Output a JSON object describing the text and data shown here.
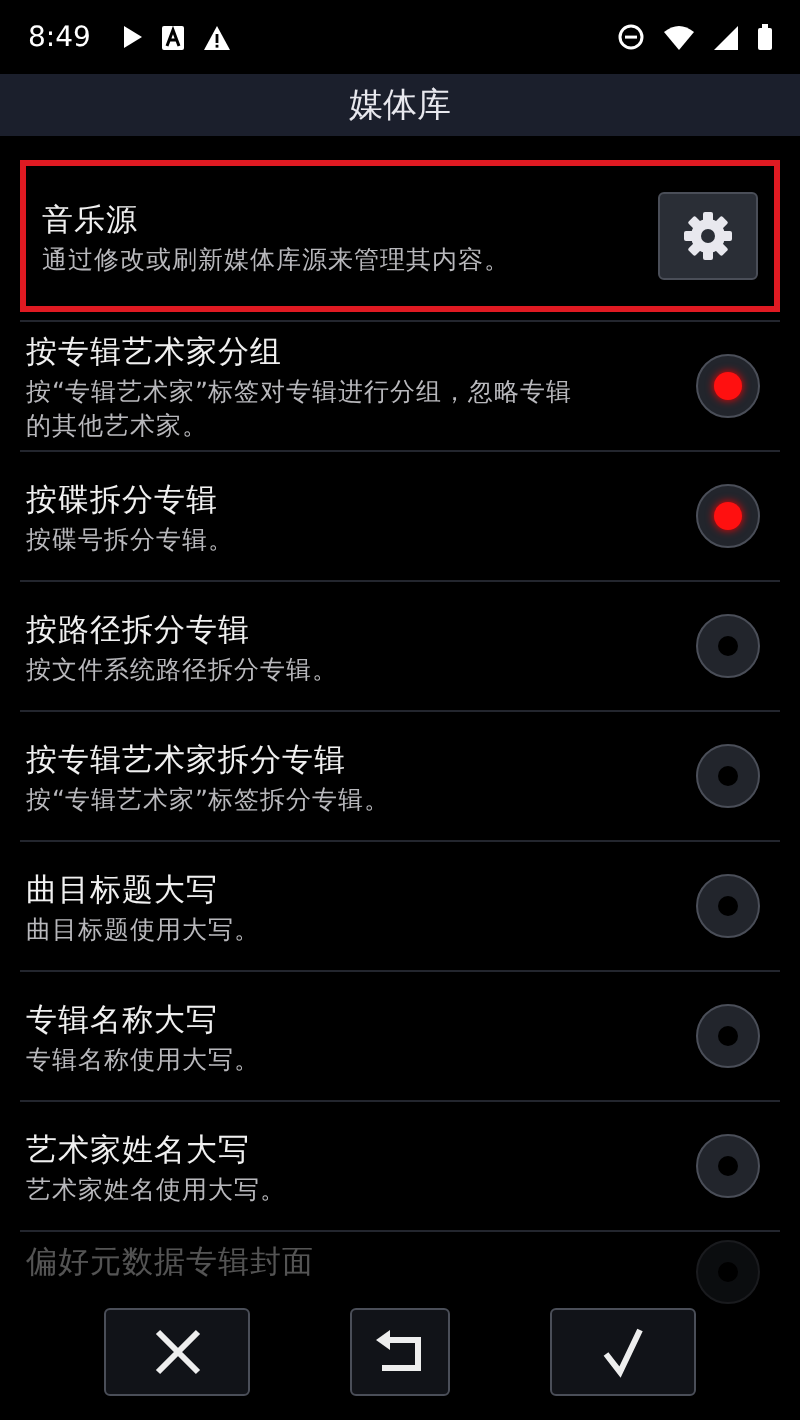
{
  "status_bar": {
    "time": "8:49"
  },
  "title": "媒体库",
  "music_source": {
    "title": "音乐源",
    "description": "通过修改或刷新媒体库源来管理其内容。",
    "highlighted": true
  },
  "options": [
    {
      "title": "按专辑艺术家分组",
      "description": "按“专辑艺术家”标签对专辑进行分组，忽略专辑的其他艺术家。",
      "selected": true
    },
    {
      "title": "按碟拆分专辑",
      "description": "按碟号拆分专辑。",
      "selected": true
    },
    {
      "title": "按路径拆分专辑",
      "description": "按文件系统路径拆分专辑。",
      "selected": false
    },
    {
      "title": "按专辑艺术家拆分专辑",
      "description": "按“专辑艺术家”标签拆分专辑。",
      "selected": false
    },
    {
      "title": "曲目标题大写",
      "description": "曲目标题使用大写。",
      "selected": false
    },
    {
      "title": "专辑名称大写",
      "description": "专辑名称使用大写。",
      "selected": false
    },
    {
      "title": "艺术家姓名大写",
      "description": "艺术家姓名使用大写。",
      "selected": false
    },
    {
      "title": "偏好元数据专辑封面",
      "selected": false
    }
  ],
  "buttons": [
    {
      "kind": "cancel"
    },
    {
      "kind": "undo"
    },
    {
      "kind": "confirm"
    }
  ]
}
